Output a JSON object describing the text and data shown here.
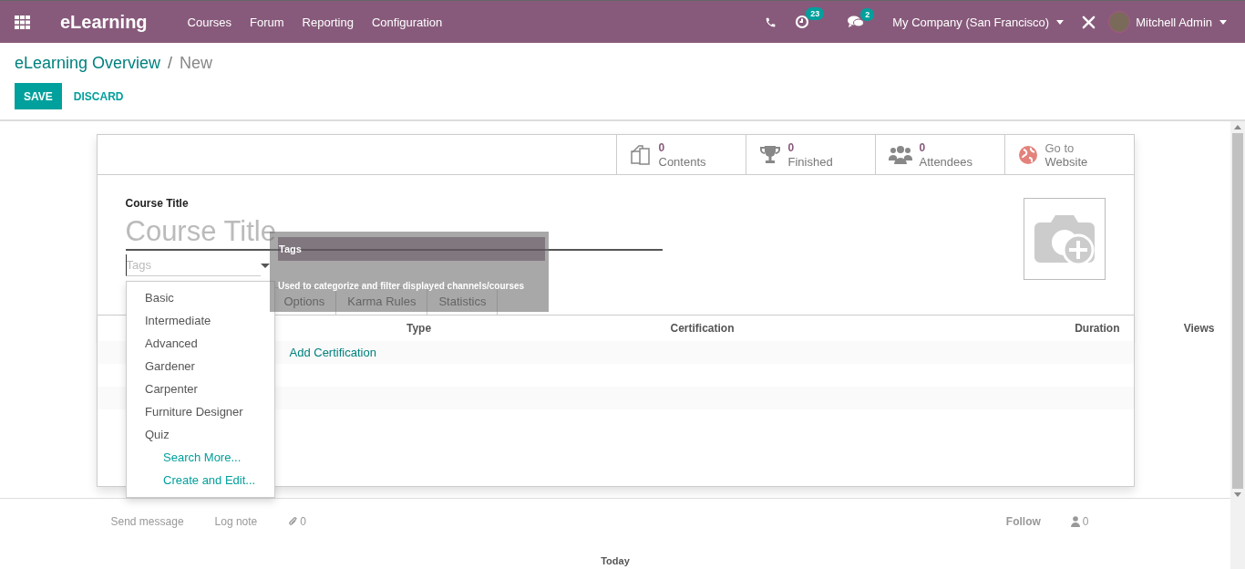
{
  "navbar": {
    "app_name": "eLearning",
    "menu": [
      "Courses",
      "Forum",
      "Reporting",
      "Configuration"
    ],
    "activity_count": "23",
    "message_count": "2",
    "company": "My Company (San Francisco)",
    "user": "Mitchell Admin"
  },
  "breadcrumb": {
    "parent": "eLearning Overview",
    "separator": "/",
    "current": "New"
  },
  "buttons": [
    {
      "label": "SAVE",
      "kind": "primary"
    },
    {
      "label": "DISCARD",
      "kind": "link"
    }
  ],
  "stat_buttons": [
    {
      "kind": "contents",
      "value": "0",
      "label": "Contents"
    },
    {
      "kind": "finished",
      "value": "0",
      "label": "Finished"
    },
    {
      "kind": "attendees",
      "value": "0",
      "label": "Attendees"
    },
    {
      "kind": "website",
      "value": "Go to",
      "label": "Website"
    }
  ],
  "form": {
    "title_label": "Course Title",
    "title_placeholder": "Course Title",
    "tags_placeholder": "Tags"
  },
  "tags_dropdown": {
    "options": [
      "Basic",
      "Intermediate",
      "Advanced",
      "Gardener",
      "Carpenter",
      "Furniture Designer",
      "Quiz"
    ],
    "actions": [
      "Search More...",
      "Create and Edit..."
    ]
  },
  "tooltip": {
    "title": "Tags",
    "text": "Used to categorize and filter displayed channels/courses"
  },
  "tabs": [
    {
      "label": "Options",
      "selected": false
    },
    {
      "label": "Karma Rules",
      "selected": false
    },
    {
      "label": "Statistics",
      "selected": false
    }
  ],
  "table": {
    "columns": [
      "Type",
      "Certification",
      "Duration",
      "Views"
    ],
    "add_link": "Add Certification"
  },
  "chatter": {
    "send_message": "Send message",
    "log_note": "Log note",
    "attachments": "0",
    "follow": "Follow",
    "followers": "0",
    "date_separator": "Today"
  }
}
